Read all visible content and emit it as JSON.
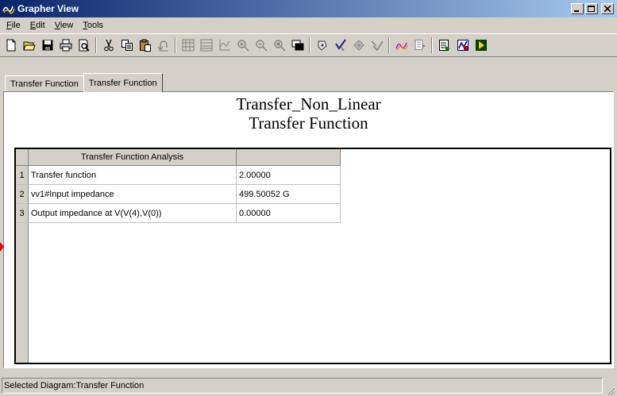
{
  "window": {
    "title": "Grapher View",
    "app_icon": "grapher-icon",
    "controls": [
      "minimize",
      "maximize",
      "close"
    ]
  },
  "menu": [
    {
      "label": "File",
      "accel": "F",
      "rest": "ile"
    },
    {
      "label": "Edit",
      "accel": "E",
      "rest": "dit"
    },
    {
      "label": "View",
      "accel": "V",
      "rest": "iew"
    },
    {
      "label": "Tools",
      "accel": "T",
      "rest": "ools"
    }
  ],
  "toolbar": {
    "buttons": [
      "new-icon",
      "open-icon",
      "save-icon",
      "print-icon",
      "print-preview-icon",
      "cut-icon",
      "copy-icon",
      "paste-icon",
      "undo-icon",
      "grid-icon",
      "lines-icon",
      "axis-icon",
      "zoom-in-icon",
      "zoom-out-icon",
      "zoom-area-icon",
      "restore-icon",
      "cursor-icon",
      "toggle-cursor-icon",
      "move-cursor-icon",
      "cursor-off-icon",
      "export-icon",
      "data-icon",
      "overlay-icon",
      "postprocess-icon",
      "step-icon"
    ]
  },
  "tabs": [
    {
      "label": "Transfer Function",
      "active": false
    },
    {
      "label": "Transfer Function",
      "active": true
    }
  ],
  "panel": {
    "title_line1": "Transfer_Non_Linear",
    "title_line2": "Transfer Function"
  },
  "table": {
    "columns": [
      "Transfer Function Analysis",
      ""
    ],
    "rows": [
      {
        "num": "1",
        "name": "Transfer function",
        "value": "2.00000"
      },
      {
        "num": "2",
        "name": "vv1#Input impedance",
        "value": "499.50052 G"
      },
      {
        "num": "3",
        "name": "Output impedance at V(V(4),V(0))",
        "value": "0.00000"
      }
    ]
  },
  "status": {
    "text": "Selected Diagram:Transfer Function"
  },
  "colors": {
    "titlebar_start": "#0a246a",
    "titlebar_end": "#a6caf0",
    "face": "#d4d0c8",
    "marker": "#e00000"
  }
}
